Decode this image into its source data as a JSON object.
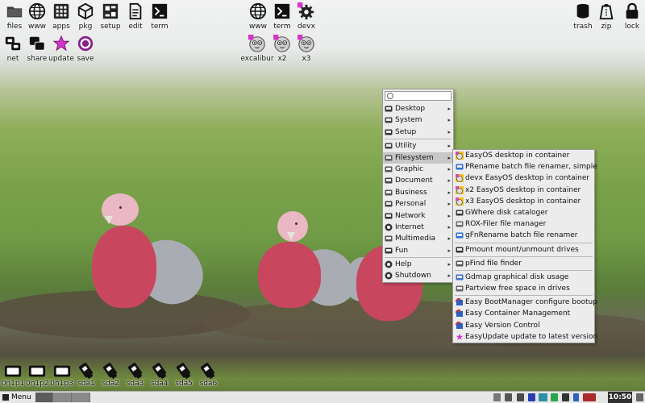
{
  "desktop_icons_left": [
    {
      "label": "files",
      "icon": "folder-icon"
    },
    {
      "label": "www",
      "icon": "globe-icon"
    },
    {
      "label": "apps",
      "icon": "apps-grid-icon"
    },
    {
      "label": "pkg",
      "icon": "package-box-icon"
    },
    {
      "label": "setup",
      "icon": "setup-icon"
    },
    {
      "label": "edit",
      "icon": "document-icon"
    },
    {
      "label": "term",
      "icon": "terminal-icon"
    },
    {
      "label": "net",
      "icon": "network-icon"
    },
    {
      "label": "share",
      "icon": "share-icon"
    },
    {
      "label": "update",
      "icon": "star-icon"
    },
    {
      "label": "save",
      "icon": "target-icon"
    }
  ],
  "desktop_icons_mid": [
    {
      "label": "www",
      "icon": "globe-icon"
    },
    {
      "label": "term",
      "icon": "terminal-icon"
    },
    {
      "label": "devx",
      "icon": "gear-icon"
    },
    {
      "label": "excalibur",
      "icon": "container-face-icon"
    },
    {
      "label": "x2",
      "icon": "container-face-icon"
    },
    {
      "label": "x3",
      "icon": "container-face-icon"
    }
  ],
  "desktop_icons_right": [
    {
      "label": "trash",
      "icon": "trash-icon"
    },
    {
      "label": "zip",
      "icon": "zip-bag-icon"
    },
    {
      "label": "lock",
      "icon": "lock-icon"
    }
  ],
  "main_menu": {
    "search_placeholder": "",
    "items": [
      {
        "label": "Desktop",
        "icon": "desktop-icon",
        "submenu": true
      },
      {
        "label": "System",
        "icon": "system-icon",
        "submenu": true
      },
      {
        "label": "Setup",
        "icon": "setup-icon",
        "submenu": true
      },
      {
        "label": "Utility",
        "icon": "utility-icon",
        "submenu": true
      },
      {
        "label": "Filesystem",
        "icon": "folder-icon",
        "submenu": true,
        "active": true
      },
      {
        "label": "Graphic",
        "icon": "graphic-icon",
        "submenu": true
      },
      {
        "label": "Document",
        "icon": "document-icon",
        "submenu": true
      },
      {
        "label": "Business",
        "icon": "business-icon",
        "submenu": true
      },
      {
        "label": "Personal",
        "icon": "personal-icon",
        "submenu": true
      },
      {
        "label": "Network",
        "icon": "network-icon",
        "submenu": true
      },
      {
        "label": "Internet",
        "icon": "globe-icon",
        "submenu": true
      },
      {
        "label": "Multimedia",
        "icon": "multimedia-icon",
        "submenu": true
      },
      {
        "label": "Fun",
        "icon": "puzzle-icon",
        "submenu": true
      },
      {
        "label": "Help",
        "icon": "help-icon",
        "submenu": true
      },
      {
        "label": "Shutdown",
        "icon": "power-icon",
        "submenu": true
      }
    ]
  },
  "filesystem_submenu": {
    "items": [
      {
        "label": "EasyOS desktop in container",
        "icon": "container-face-icon"
      },
      {
        "label": "PRename batch file renamer, simple",
        "icon": "rename-icon"
      },
      {
        "label": "devx EasyOS desktop in container",
        "icon": "container-face-icon"
      },
      {
        "label": "x2 EasyOS desktop in container",
        "icon": "container-face-icon"
      },
      {
        "label": "x3 EasyOS desktop in container",
        "icon": "container-face-icon"
      },
      {
        "label": "GWhere disk cataloger",
        "icon": "gwhere-icon"
      },
      {
        "label": "ROX-Filer file manager",
        "icon": "rox-icon"
      },
      {
        "label": "gFnRename batch file renamer",
        "icon": "rename-icon"
      },
      {
        "label": "Pmount mount/unmount drives",
        "icon": "drive-icon"
      },
      {
        "label": "pFind file finder",
        "icon": "magnifier-icon"
      },
      {
        "label": "Gdmap graphical disk usage",
        "icon": "chart-icon"
      },
      {
        "label": "Partview free space in drives",
        "icon": "partition-icon"
      },
      {
        "label": "Easy BootManager configure bootup",
        "icon": "boot-icon"
      },
      {
        "label": "Easy Container Management",
        "icon": "boot-icon"
      },
      {
        "label": "Easy Version Control",
        "icon": "boot-icon"
      },
      {
        "label": "EasyUpdate update to latest version",
        "icon": "star-icon"
      }
    ]
  },
  "drives": [
    {
      "label": "0n1p1",
      "icon": "hard-drive-icon"
    },
    {
      "label": "0n1p2",
      "icon": "hard-drive-icon"
    },
    {
      "label": "0n1p3",
      "icon": "hard-drive-icon"
    },
    {
      "label": "sda1",
      "icon": "usb-drive-icon"
    },
    {
      "label": "sda2",
      "icon": "usb-drive-icon"
    },
    {
      "label": "sda3",
      "icon": "usb-drive-icon"
    },
    {
      "label": "sda4",
      "icon": "usb-drive-icon"
    },
    {
      "label": "sda5",
      "icon": "usb-drive-icon"
    },
    {
      "label": "sda6",
      "icon": "usb-drive-icon"
    }
  ],
  "taskbar": {
    "menu_label": "Menu",
    "clock": "10:50",
    "colors": {
      "clock_bg": "#303030",
      "accent_pink": "#c8475f"
    }
  }
}
